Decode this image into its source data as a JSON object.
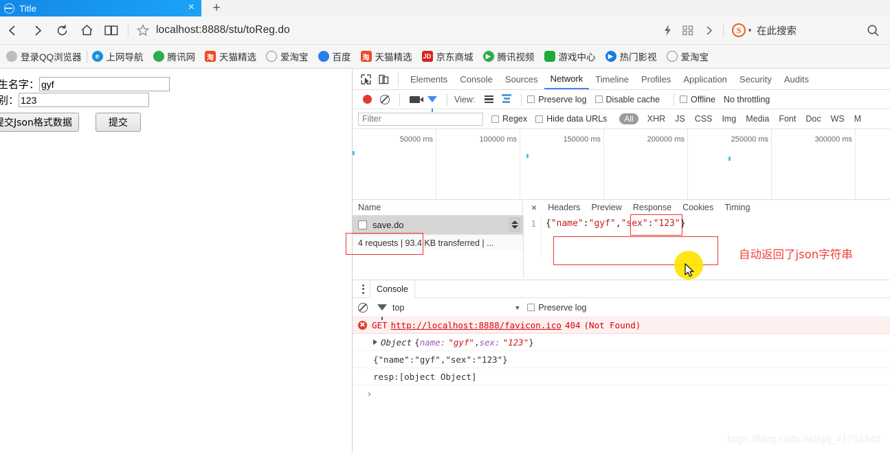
{
  "browser": {
    "tab": {
      "title": "Title",
      "close_label": "×",
      "favicon": "globe-icon"
    },
    "newtab_label": "+",
    "url": "localhost:8888/stu/toReg.do",
    "search_placeholder": "在此搜索",
    "search_engine_badge": "S",
    "bookmarks": [
      {
        "label": "登录QQ浏览器",
        "icon": "user-avatar-icon",
        "color": "#b9b9b9"
      },
      {
        "label": "上网导航",
        "icon": "e-browser-icon",
        "color": "#1a8fe0"
      },
      {
        "label": "腾讯网",
        "icon": "qq-globe-icon",
        "color": "#2cae4a"
      },
      {
        "label": "天猫精选",
        "icon": "taobao-icon",
        "color": "#f4481f"
      },
      {
        "label": "爱淘宝",
        "icon": "globe-outline-icon",
        "color": "#8a8a8a"
      },
      {
        "label": "百度",
        "icon": "baidu-paw-icon",
        "color": "#2b7de9"
      },
      {
        "label": "天猫精选",
        "icon": "taobao-icon",
        "color": "#f4481f"
      },
      {
        "label": "京东商城",
        "icon": "jd-icon",
        "color": "#d8231e"
      },
      {
        "label": "腾讯视频",
        "icon": "play-circle-icon",
        "color": "#2eaa4a"
      },
      {
        "label": "游戏中心",
        "icon": "gamepad-icon",
        "color": "#1faa3e"
      },
      {
        "label": "热门影视",
        "icon": "play-blue-icon",
        "color": "#1a7ae0"
      },
      {
        "label": "爱淘宝",
        "icon": "globe-outline-icon",
        "color": "#8a8a8a"
      }
    ]
  },
  "page_form": {
    "name_label": "学生名字：",
    "name_value": "gyf",
    "sex_label": "性别：",
    "sex_value": "123",
    "submit_json_label": "提交Json格式数据",
    "submit_label": "提交"
  },
  "devtools": {
    "tabs": [
      "Elements",
      "Console",
      "Sources",
      "Network",
      "Timeline",
      "Profiles",
      "Application",
      "Security",
      "Audits"
    ],
    "selected_tab": "Network",
    "toolbar": {
      "view_label": "View:",
      "preserve_log": "Preserve log",
      "disable_cache": "Disable cache",
      "offline": "Offline",
      "throttling": "No throttling"
    },
    "filterbar": {
      "filter_placeholder": "Filter",
      "regex_label": "Regex",
      "hide_data_urls_label": "Hide data URLs",
      "all_label": "All",
      "types": [
        "XHR",
        "JS",
        "CSS",
        "Img",
        "Media",
        "Font",
        "Doc",
        "WS",
        "M"
      ]
    },
    "overview": {
      "ticks": [
        "50000 ms",
        "100000 ms",
        "150000 ms",
        "200000 ms",
        "250000 ms",
        "300000 ms"
      ]
    },
    "network": {
      "column_name": "Name",
      "rows": [
        {
          "name": "save.do"
        }
      ],
      "summary": "4 requests  |  93.4 KB transferred  |  ..."
    },
    "request_detail": {
      "close_label": "×",
      "tabs": [
        "Headers",
        "Preview",
        "Response",
        "Cookies",
        "Timing"
      ],
      "selected_tab": "Response",
      "line_number": "1",
      "response_body": "{\"name\":\"gyf\",\"sex\":\"123\"}"
    },
    "annotation": "自动返回了json字符串",
    "drawer": {
      "tab_label": "Console",
      "context": "top",
      "preserve_log_label": "Preserve log",
      "logs": [
        {
          "type": "error",
          "method": "GET",
          "url": "http://localhost:8888/favicon.ico",
          "status": "404",
          "text": "(Not Found)"
        },
        {
          "type": "object",
          "prefix": "Object",
          "open": "{",
          "key1": "name:",
          "val1": "\"gyf\"",
          "sep": ", ",
          "key2": "sex:",
          "val2": "\"123\"",
          "close": "}"
        },
        {
          "type": "plain",
          "text": "{\"name\":\"gyf\",\"sex\":\"123\"}"
        },
        {
          "type": "plain",
          "text": "resp:[object Object]"
        }
      ]
    }
  },
  "watermark": "https://blog.csdn.net/qq_41753340",
  "colors": {
    "tab_blue": "#1489e8",
    "accent_red": "#e8352a",
    "annotation_red": "#f0413a",
    "string_red": "#c41a16",
    "devtools_selected": "#4285f4",
    "cursor_highlight": "#ffe400"
  }
}
